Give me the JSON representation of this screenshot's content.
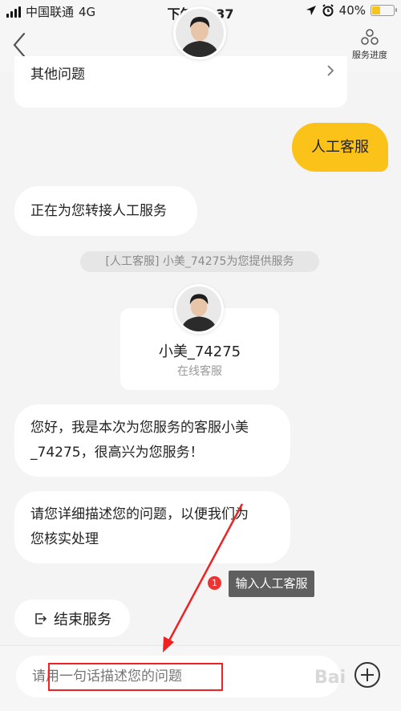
{
  "status_bar": {
    "carrier": "中国联通",
    "network": "4G",
    "time": "下午12:37",
    "battery": "40%",
    "battery_level": 0.4
  },
  "nav": {
    "service_progress_label": "服务进度"
  },
  "messages": {
    "previous_item": "其他问题",
    "user_message": "人工客服",
    "transfer_message": "正在为您转接人工服务",
    "notice": "[人工客服] 小美_74275为您提供服务",
    "greeting_line1": "您好，我是本次为您服务的客服小美",
    "greeting_line2": "_74275，很高兴为您服务！",
    "request_line1": "请您详细描述您的问题，以便我们为",
    "request_line2": "您核实处理"
  },
  "agent": {
    "name": "小美_74275",
    "status": "在线客服"
  },
  "annotation": {
    "badge": "1",
    "tooltip": "输入人工客服"
  },
  "end_service_label": "结束服务",
  "input": {
    "placeholder": "请用一句话描述您的问题"
  },
  "watermark": "Bai",
  "colors": {
    "accent": "#fbc31a",
    "annotation_red": "#e22222"
  }
}
